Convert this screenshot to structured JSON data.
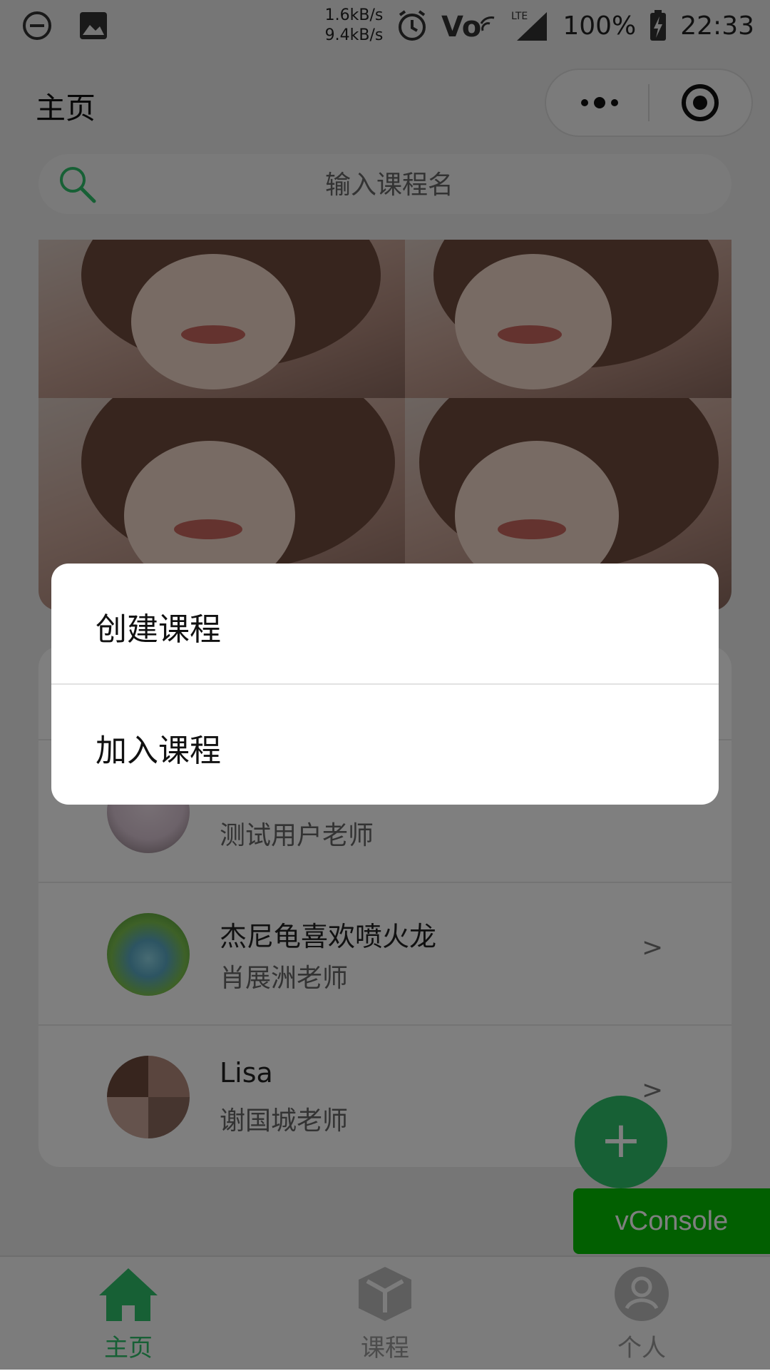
{
  "status_bar": {
    "speed_up": "1.6kB/s",
    "speed_down": "9.4kB/s",
    "network_label": "LTE",
    "battery": "100%",
    "time": "22:33"
  },
  "header": {
    "title": "主页"
  },
  "search": {
    "placeholder": "输入课程名"
  },
  "courses": [
    {
      "title": "",
      "teacher": "测试用户老师",
      "arrow": ">"
    },
    {
      "title": "杰尼龟喜欢喷火龙",
      "teacher": "肖展洲老师",
      "arrow": ">"
    },
    {
      "title": "Lisa",
      "teacher": "谢国城老师",
      "arrow": ">"
    }
  ],
  "fab": {
    "label": "+"
  },
  "vconsole": {
    "label": "vConsole"
  },
  "tabbar": {
    "items": [
      {
        "label": "主页",
        "active": true
      },
      {
        "label": "课程",
        "active": false
      },
      {
        "label": "个人",
        "active": false
      }
    ]
  },
  "action_sheet": {
    "items": [
      {
        "label": "创建课程"
      },
      {
        "label": "加入课程"
      }
    ]
  },
  "colors": {
    "accent": "#2fc16b",
    "vconsole": "#04be02",
    "mask": "rgba(0,0,0,0.5)"
  }
}
